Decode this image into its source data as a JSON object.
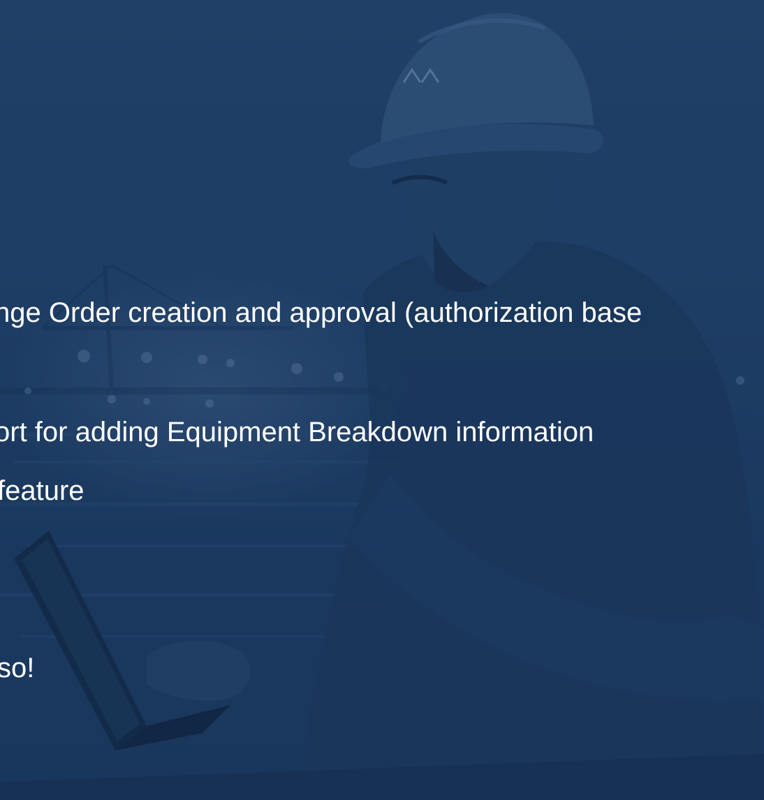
{
  "slide": {
    "background_color": "#1d3b62",
    "text_color": "#ffffff",
    "lines": [
      "nge Order creation and approval (authorization base",
      "ort for adding Equipment Breakdown information",
      " feature",
      "so!"
    ]
  }
}
